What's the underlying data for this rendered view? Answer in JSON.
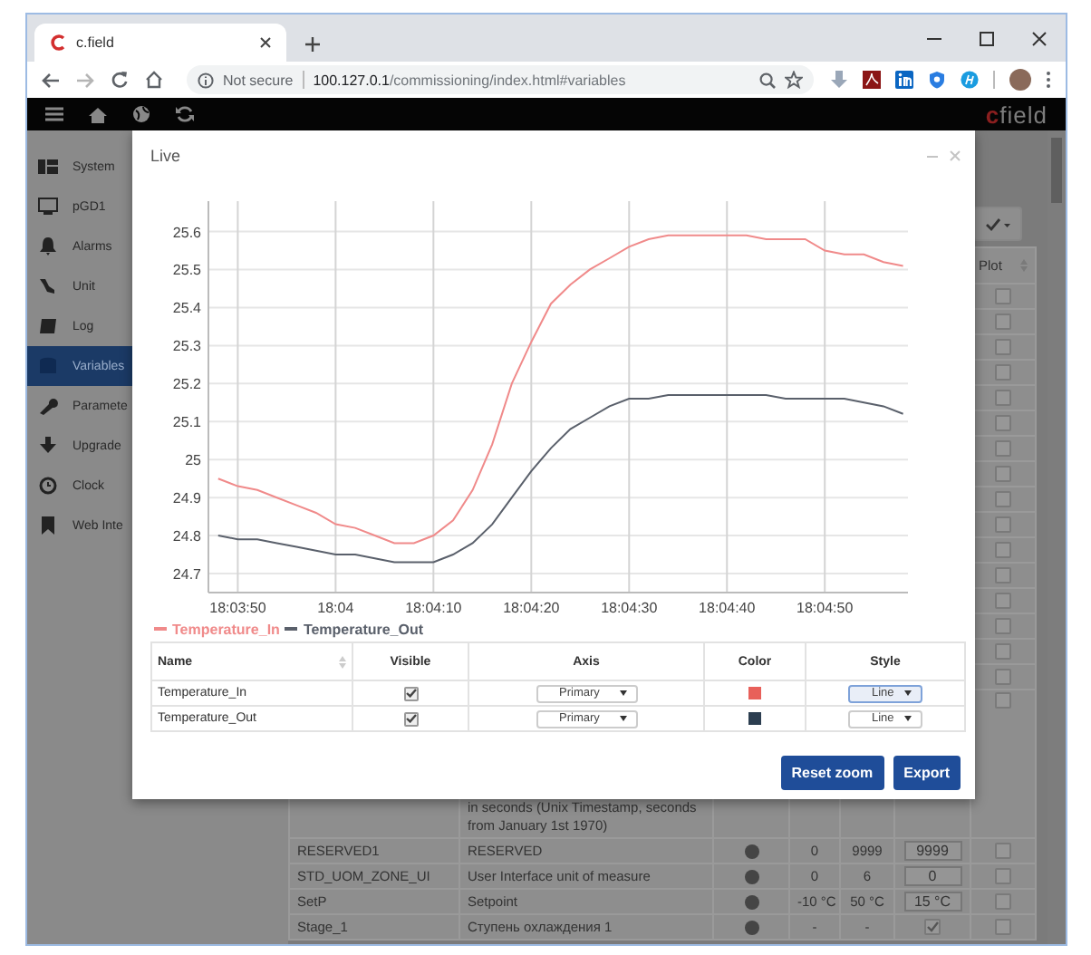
{
  "browser": {
    "tab_title": "c.field",
    "security_label": "Not secure",
    "url_host": "100.127.0.1",
    "url_path": "/commissioning/index.html#variables"
  },
  "app_header": {
    "logo_mark": "c",
    "logo_text": "field"
  },
  "sidebar": {
    "items": [
      {
        "label": "System",
        "selected": false
      },
      {
        "label": "pGD1",
        "selected": false
      },
      {
        "label": "Alarms",
        "selected": false
      },
      {
        "label": "Unit",
        "selected": false
      },
      {
        "label": "Log",
        "selected": false
      },
      {
        "label": "Variables",
        "selected": true
      },
      {
        "label": "Paramete",
        "selected": false
      },
      {
        "label": "Upgrade",
        "selected": false
      },
      {
        "label": "Clock",
        "selected": false
      },
      {
        "label": "Web Inte",
        "selected": false
      }
    ]
  },
  "variables_table": {
    "plot_header": "Plot",
    "rows": [
      {
        "plot_checked": false
      },
      {
        "plot_checked": false
      },
      {
        "plot_checked": false
      },
      {
        "plot_checked": false
      },
      {
        "plot_checked": false
      },
      {
        "plot_checked": false
      },
      {
        "plot_checked": false
      },
      {
        "plot_checked": false
      },
      {
        "plot_checked": false
      },
      {
        "plot_checked": false
      },
      {
        "plot_checked": false
      },
      {
        "plot_checked": false
      },
      {
        "plot_checked": false
      },
      {
        "plot_checked": false
      },
      {
        "plot_checked": false
      },
      {
        "plot_checked": false
      },
      {
        "description": "in seconds (Unix Timestamp, seconds from January 1st 1970)",
        "plot_checked": false
      },
      {
        "name": "RESERVED1",
        "description": "RESERVED",
        "min": "0",
        "max": "9999",
        "kind": "field",
        "value": "9999",
        "plot_checked": false
      },
      {
        "name": "STD_UOM_ZONE_UI",
        "description": "User Interface unit of measure",
        "min": "0",
        "max": "6",
        "kind": "field",
        "value": "0",
        "plot_checked": false
      },
      {
        "name": "SetP",
        "description": "Setpoint",
        "min": "-10 °C",
        "max": "50 °C",
        "kind": "field",
        "value": "15 °C",
        "plot_checked": false
      },
      {
        "name": "Stage_1",
        "description": "Ступень охлаждения 1",
        "min": "-",
        "max": "-",
        "kind": "checkbox",
        "value_checked": true,
        "plot_checked": false
      }
    ]
  },
  "live_dialog": {
    "title": "Live",
    "chart_data": {
      "type": "line",
      "categories": [
        null,
        "18:03:50",
        null,
        null,
        null,
        null,
        "18:04",
        null,
        null,
        null,
        null,
        "18:04:10",
        null,
        null,
        null,
        null,
        "18:04:20",
        null,
        null,
        null,
        null,
        "18:04:30",
        null,
        null,
        null,
        null,
        "18:04:40",
        null,
        null,
        null,
        null,
        "18:04:50",
        null,
        null,
        null,
        null
      ],
      "series": [
        {
          "name": "Temperature_In",
          "color": "#f08a8a",
          "values": [
            24.95,
            24.93,
            24.92,
            24.9,
            24.88,
            24.86,
            24.83,
            24.82,
            24.8,
            24.78,
            24.78,
            24.8,
            24.84,
            24.92,
            25.04,
            25.2,
            25.31,
            25.41,
            25.46,
            25.5,
            25.53,
            25.56,
            25.58,
            25.59,
            25.59,
            25.59,
            25.59,
            25.59,
            25.58,
            25.58,
            25.58,
            25.55,
            25.54,
            25.54,
            25.52,
            25.51
          ]
        },
        {
          "name": "Temperature_Out",
          "color": "#5a606b",
          "values": [
            24.8,
            24.79,
            24.79,
            24.78,
            24.77,
            24.76,
            24.75,
            24.75,
            24.74,
            24.73,
            24.73,
            24.73,
            24.75,
            24.78,
            24.83,
            24.9,
            24.97,
            25.03,
            25.08,
            25.11,
            25.14,
            25.16,
            25.16,
            25.17,
            25.17,
            25.17,
            25.17,
            25.17,
            25.17,
            25.16,
            25.16,
            25.16,
            25.16,
            25.15,
            25.14,
            25.12
          ]
        }
      ],
      "ylim": [
        24.65,
        25.68
      ],
      "grid": true,
      "yticks": [
        24.7,
        24.8,
        24.9,
        25,
        25.1,
        25.2,
        25.3,
        25.4,
        25.5,
        25.6
      ]
    },
    "columns": [
      "Name",
      "Visible",
      "Axis",
      "Color",
      "Style"
    ],
    "series": [
      {
        "name": "Temperature_In",
        "visible": true,
        "axis": "Primary",
        "color": "#e8605a",
        "style": "Line",
        "focused": true
      },
      {
        "name": "Temperature_Out",
        "visible": true,
        "axis": "Primary",
        "color": "#2c3e50",
        "style": "Line",
        "focused": false
      }
    ],
    "buttons": [
      "Reset zoom",
      "Export"
    ]
  }
}
